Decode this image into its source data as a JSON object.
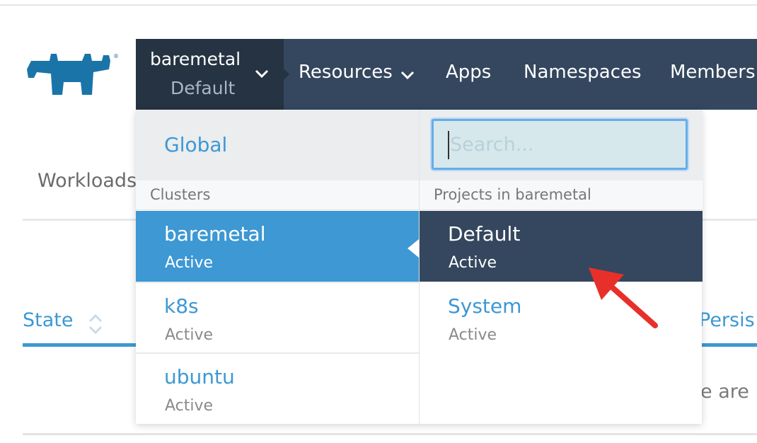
{
  "nav": {
    "cluster_name": "baremetal",
    "project_name": "Default",
    "items": [
      {
        "label": "Resources"
      },
      {
        "label": "Apps"
      },
      {
        "label": "Namespaces"
      },
      {
        "label": "Members"
      }
    ]
  },
  "page": {
    "tab_label": "Workloads",
    "columns": {
      "state": "State",
      "persistent": "Persis"
    },
    "empty_text": "e are"
  },
  "dropdown": {
    "global_label": "Global",
    "clusters_header": "Clusters",
    "projects_header": "Projects in baremetal",
    "search_placeholder": "Search...",
    "clusters": [
      {
        "name": "baremetal",
        "status": "Active",
        "selected": true
      },
      {
        "name": "k8s",
        "status": "Active",
        "selected": false
      },
      {
        "name": "ubuntu",
        "status": "Active",
        "selected": false
      }
    ],
    "projects": [
      {
        "name": "Default",
        "status": "Active",
        "selected": true
      },
      {
        "name": "System",
        "status": "Active",
        "selected": false
      }
    ]
  },
  "colors": {
    "nav_bg": "#34475e",
    "switcher_bg": "#253342",
    "accent": "#3d98d3",
    "annotation": "#e8302a"
  },
  "icons": {
    "logo": "rancher-logo",
    "chevron": "chevron-down-icon",
    "sort": "sort-icon",
    "annotation": "red-arrow"
  }
}
